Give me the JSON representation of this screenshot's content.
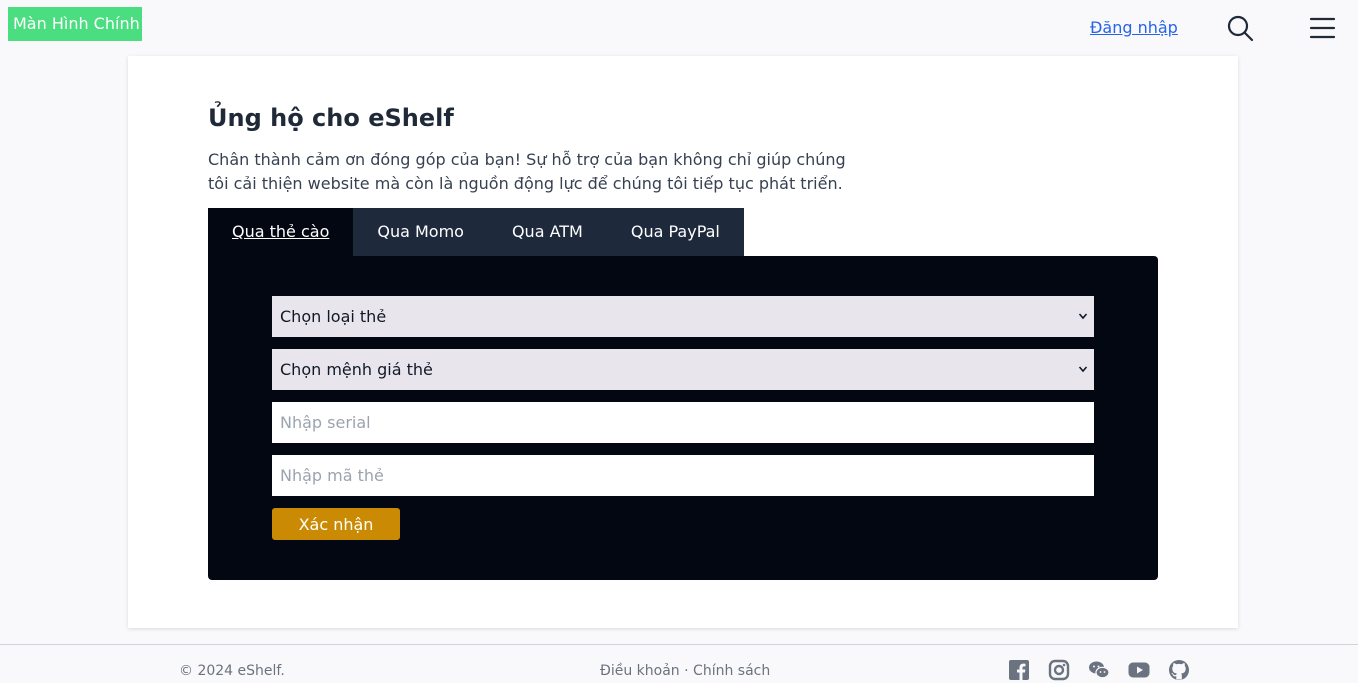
{
  "header": {
    "brand": "Màn Hình Chính",
    "login": "Đăng nhập",
    "icons": [
      "search-icon",
      "menu-icon"
    ]
  },
  "main": {
    "title": "Ủng hộ cho eShelf",
    "description": "Chân thành cảm ơn đóng góp của bạn! Sự hỗ trợ của bạn không chỉ giúp chúng tôi cải thiện website mà còn là nguồn động lực để chúng tôi tiếp tục phát triển.",
    "tabs": [
      {
        "label": "Qua thẻ cào",
        "active": true
      },
      {
        "label": "Qua Momo",
        "active": false
      },
      {
        "label": "Qua ATM",
        "active": false
      },
      {
        "label": "Qua PayPal",
        "active": false
      }
    ],
    "form": {
      "card_type": "Chọn loại thẻ",
      "card_value": "Chọn mệnh giá thẻ",
      "serial_placeholder": "Nhập serial",
      "code_placeholder": "Nhập mã thẻ",
      "submit": "Xác nhận"
    }
  },
  "footer": {
    "copyright": "© 2024 eShelf.",
    "terms": "Điều khoản",
    "separator": "·",
    "policy": "Chính sách",
    "social_icons": [
      "facebook-icon",
      "instagram-icon",
      "wechat-icon",
      "youtube-icon",
      "github-icon"
    ]
  },
  "colors": {
    "brand_bg": "#4ade80",
    "link": "#2563eb",
    "panel_bg": "#030712",
    "tab_bg": "#1e293b",
    "button": "#ca8a04",
    "select_bg": "#e8e6ec"
  }
}
